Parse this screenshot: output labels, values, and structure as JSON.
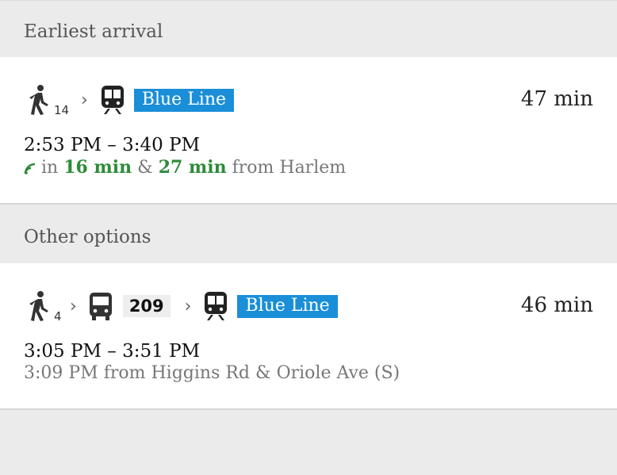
{
  "sections": [
    {
      "header": "Earliest arrival",
      "option": {
        "walk_minutes": "14",
        "line_label": "Blue Line",
        "duration": "47 min",
        "time_range": "2:53 PM – 3:40 PM",
        "realtime": {
          "prefix": "in",
          "first": "16 min",
          "connector": "&",
          "second": "27 min",
          "suffix": "from Harlem"
        }
      }
    },
    {
      "header": "Other options",
      "option": {
        "walk_minutes": "4",
        "bus_route": "209",
        "line_label": "Blue Line",
        "duration": "46 min",
        "time_range": "3:05 PM – 3:51 PM",
        "departure": "3:09 PM from Higgins Rd & Oriole Ave (S)"
      }
    }
  ],
  "colors": {
    "blue_line": "#1a8fd8",
    "realtime_green": "#2e8b3a",
    "background": "#ebebeb"
  },
  "icons": [
    "walk-icon",
    "chevron-right-icon",
    "train-icon",
    "bus-icon",
    "realtime-signal-icon"
  ]
}
